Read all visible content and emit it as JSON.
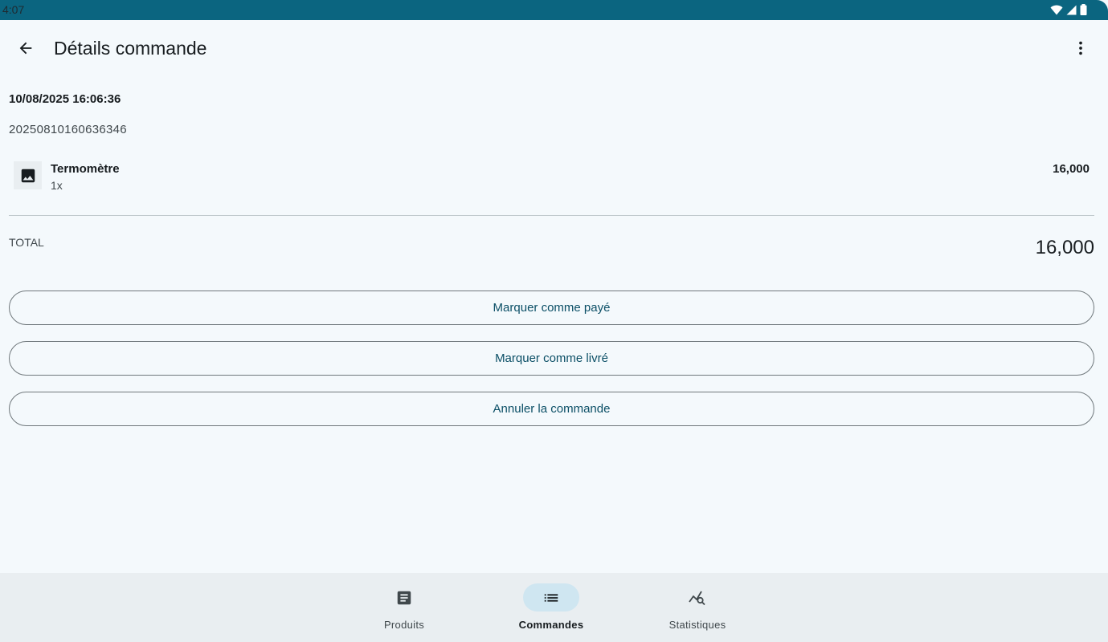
{
  "status_bar": {
    "time": "4:07",
    "icons": [
      "wifi-icon",
      "cell-signal-icon",
      "battery-icon"
    ]
  },
  "top_bar": {
    "title": "Détails commande",
    "back_icon": "arrow-back-icon",
    "menu_icon": "more-vert-icon"
  },
  "order": {
    "date": "10/08/2025 16:06:36",
    "id": "20250810160636346",
    "items": [
      {
        "name": "Termomètre",
        "quantity": "1x",
        "price": "16,000",
        "thumb_icon": "image-icon"
      }
    ],
    "total_label": "TOTAL",
    "total_value": "16,000"
  },
  "actions": {
    "mark_paid": "Marquer comme payé",
    "mark_delivered": "Marquer comme livré",
    "cancel": "Annuler la commande"
  },
  "bottom_nav": {
    "items": [
      {
        "label": "Produits",
        "icon": "article-icon",
        "active": false
      },
      {
        "label": "Commandes",
        "icon": "list-icon",
        "active": true
      },
      {
        "label": "Statistiques",
        "icon": "query-stats-icon",
        "active": false
      }
    ]
  },
  "colors": {
    "status_bar": "#0b6580",
    "background": "#f4f9fc",
    "accent_text": "#0b4f66",
    "nav_active_pill": "#cfe6f1",
    "nav_background": "#e9eef1"
  }
}
